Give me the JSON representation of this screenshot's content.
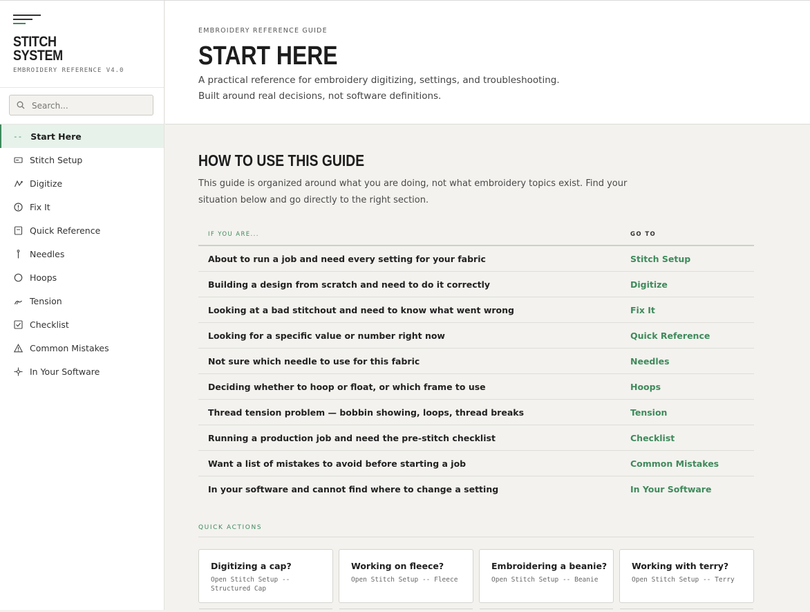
{
  "sidebar": {
    "brand_line1": "STITCH",
    "brand_line2": "SYSTEM",
    "brand_sub": "EMBROIDERY REFERENCE V4.0",
    "search_placeholder": "Search...",
    "items": [
      {
        "label": "Start Here",
        "icon": "dash-marker",
        "active": true
      },
      {
        "label": "Stitch Setup",
        "icon": "stitch-setup-icon"
      },
      {
        "label": "Digitize",
        "icon": "pen-path-icon"
      },
      {
        "label": "Fix It",
        "icon": "alert-circle-icon"
      },
      {
        "label": "Quick Reference",
        "icon": "document-icon"
      },
      {
        "label": "Needles",
        "icon": "needle-icon"
      },
      {
        "label": "Hoops",
        "icon": "hoop-circle-icon"
      },
      {
        "label": "Tension",
        "icon": "tension-icon"
      },
      {
        "label": "Checklist",
        "icon": "checkbox-icon"
      },
      {
        "label": "Common Mistakes",
        "icon": "warning-triangle-icon"
      },
      {
        "label": "In Your Software",
        "icon": "crosshair-icon"
      }
    ]
  },
  "header": {
    "eyebrow": "EMBROIDERY REFERENCE GUIDE",
    "title": "START HERE",
    "intro": "A practical reference for embroidery digitizing, settings, and troubleshooting. Built around real decisions, not software definitions."
  },
  "guide": {
    "title": "HOW TO USE THIS GUIDE",
    "description": "This guide is organized around what you are doing, not what embroidery topics exist. Find your situation below and go directly to the right section.",
    "col_situation": "IF YOU ARE...",
    "col_goto": "GO TO",
    "rows": [
      {
        "situation": "About to run a job and need every setting for your fabric",
        "goto": "Stitch Setup"
      },
      {
        "situation": "Building a design from scratch and need to do it correctly",
        "goto": "Digitize"
      },
      {
        "situation": "Looking at a bad stitchout and need to know what went wrong",
        "goto": "Fix It"
      },
      {
        "situation": "Looking for a specific value or number right now",
        "goto": "Quick Reference"
      },
      {
        "situation": "Not sure which needle to use for this fabric",
        "goto": "Needles"
      },
      {
        "situation": "Deciding whether to hoop or float, or which frame to use",
        "goto": "Hoops"
      },
      {
        "situation": "Thread tension problem — bobbin showing, loops, thread breaks",
        "goto": "Tension"
      },
      {
        "situation": "Running a production job and need the pre-stitch checklist",
        "goto": "Checklist"
      },
      {
        "situation": "Want a list of mistakes to avoid before starting a job",
        "goto": "Common Mistakes"
      },
      {
        "situation": "In your software and cannot find where to change a setting",
        "goto": "In Your Software"
      }
    ]
  },
  "quick_actions": {
    "label": "QUICK ACTIONS",
    "cards": [
      {
        "title": "Digitizing a cap?",
        "sub": "Open Stitch Setup -- Structured Cap"
      },
      {
        "title": "Working on fleece?",
        "sub": "Open Stitch Setup -- Fleece"
      },
      {
        "title": "Embroidering a beanie?",
        "sub": "Open Stitch Setup -- Beanie"
      },
      {
        "title": "Working with terry?",
        "sub": "Open Stitch Setup -- Terry"
      }
    ]
  },
  "colors": {
    "accent": "#3f8a5c",
    "active_bg": "#e6f2ea",
    "page_bg": "#f3f2ee"
  }
}
